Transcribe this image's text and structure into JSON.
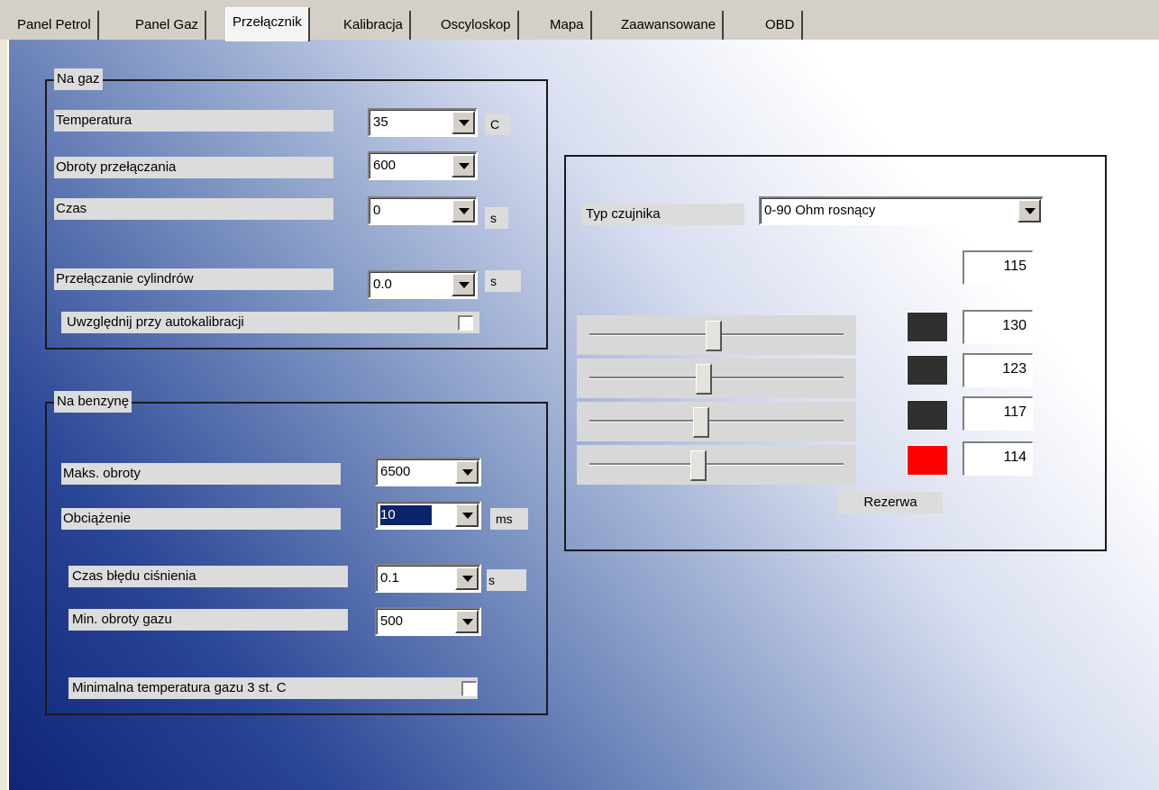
{
  "tabs": [
    {
      "label": "Panel Petrol"
    },
    {
      "label": "Panel Gaz"
    },
    {
      "label": "Przełącznik"
    },
    {
      "label": "Kalibracja"
    },
    {
      "label": "Oscyloskop"
    },
    {
      "label": "Mapa"
    },
    {
      "label": "Zaawansowane"
    },
    {
      "label": "OBD"
    }
  ],
  "selected_tab": "Przełącznik",
  "na_gaz": {
    "title": "Na gaz",
    "temperatura": {
      "label": "Temperatura",
      "value": "35",
      "unit": "C"
    },
    "obroty": {
      "label": "Obroty przełączania",
      "value": "600"
    },
    "czas": {
      "label": "Czas",
      "value": "0",
      "unit": "s"
    },
    "cylindry": {
      "label": "Przełączanie cylindrów",
      "value": "0.0",
      "unit": "s"
    },
    "autokal": {
      "label": "Uwzględnij przy autokalibracji",
      "checked": false
    }
  },
  "na_benzyne": {
    "title": "Na benzynę",
    "maks_obroty": {
      "label": "Maks. obroty",
      "value": "6500"
    },
    "obciazenie": {
      "label": "Obciążenie",
      "value": "10",
      "unit": "ms"
    },
    "czas_bledu": {
      "label": "Czas błędu ciśnienia",
      "value": "0.1",
      "unit": "s"
    },
    "min_obroty": {
      "label": "Min. obroty gazu",
      "value": "500"
    },
    "min_temp": {
      "label": "Minimalna temperatura gazu 3 st. C",
      "checked": false
    }
  },
  "sensor": {
    "typ_label": "Typ czujnika",
    "typ_value": "0-90 Ohm rosnący",
    "top_value": "115",
    "levels": [
      {
        "value": "130",
        "color": "#303030",
        "slider_pos": 0.49
      },
      {
        "value": "123",
        "color": "#303030",
        "slider_pos": 0.45
      },
      {
        "value": "117",
        "color": "#303030",
        "slider_pos": 0.44
      },
      {
        "value": "114",
        "color": "#ff0000",
        "slider_pos": 0.43
      }
    ],
    "rezerwa": "Rezerwa"
  }
}
